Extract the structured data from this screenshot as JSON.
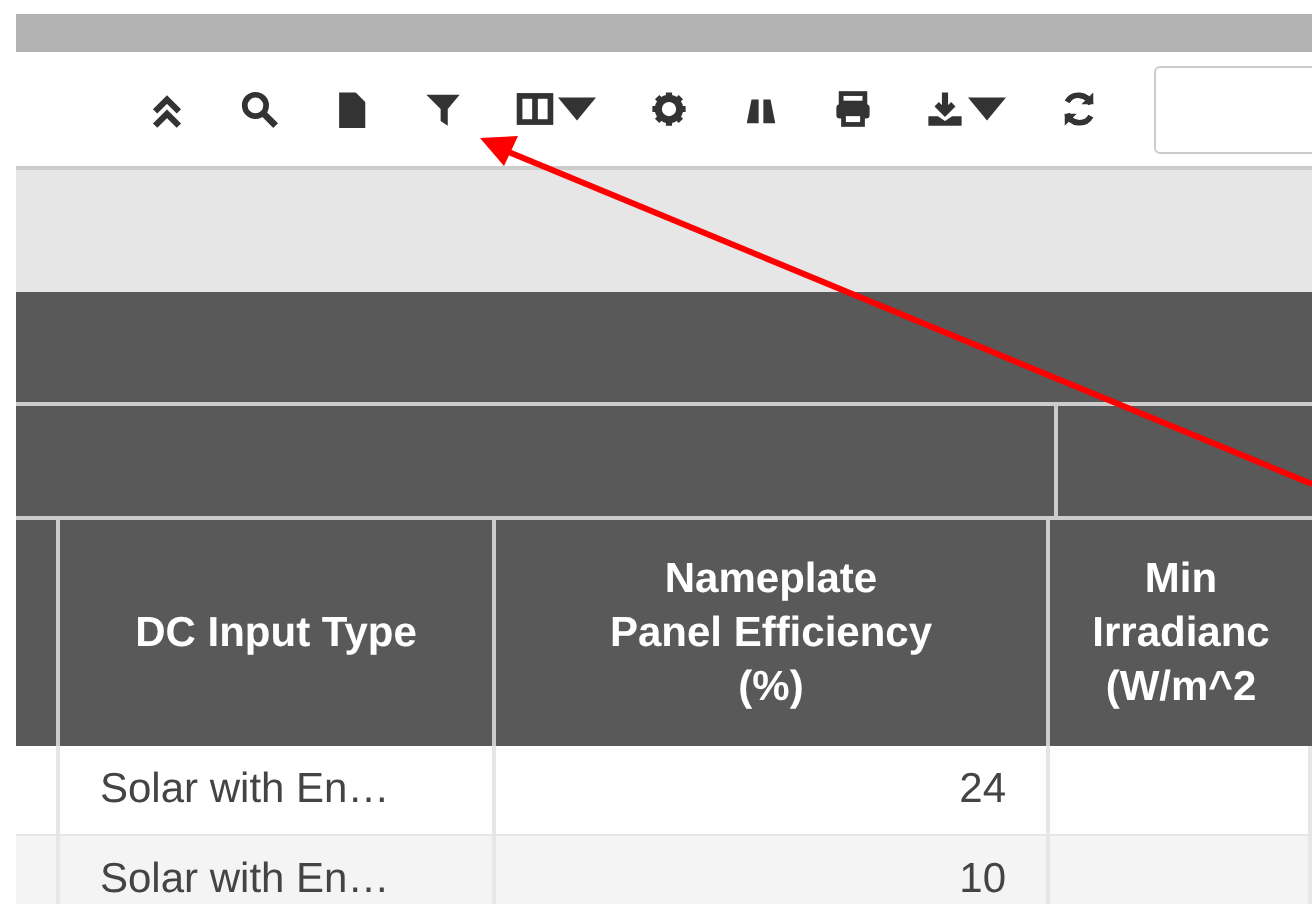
{
  "table": {
    "columns": [
      {},
      {
        "lines": [
          "DC Input Type"
        ]
      },
      {
        "lines": [
          "Nameplate",
          "Panel Efficiency",
          "(%)"
        ]
      },
      {
        "lines": [
          "Min",
          "Irradianc",
          "(W/m^2"
        ]
      }
    ],
    "rows": [
      {
        "cells": [
          "",
          "Solar with En…",
          "24",
          ""
        ]
      },
      {
        "cells": [
          "",
          "Solar with En…",
          "10",
          ""
        ]
      }
    ]
  }
}
